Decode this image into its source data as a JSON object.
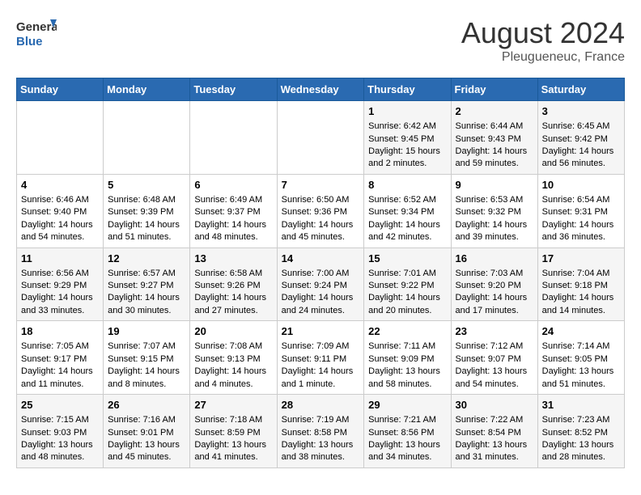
{
  "header": {
    "logo_line1": "General",
    "logo_line2": "Blue",
    "month_year": "August 2024",
    "location": "Pleugueneuc, France"
  },
  "days_of_week": [
    "Sunday",
    "Monday",
    "Tuesday",
    "Wednesday",
    "Thursday",
    "Friday",
    "Saturday"
  ],
  "weeks": [
    [
      {
        "day": "",
        "info": ""
      },
      {
        "day": "",
        "info": ""
      },
      {
        "day": "",
        "info": ""
      },
      {
        "day": "",
        "info": ""
      },
      {
        "day": "1",
        "info": "Sunrise: 6:42 AM\nSunset: 9:45 PM\nDaylight: 15 hours\nand 2 minutes."
      },
      {
        "day": "2",
        "info": "Sunrise: 6:44 AM\nSunset: 9:43 PM\nDaylight: 14 hours\nand 59 minutes."
      },
      {
        "day": "3",
        "info": "Sunrise: 6:45 AM\nSunset: 9:42 PM\nDaylight: 14 hours\nand 56 minutes."
      }
    ],
    [
      {
        "day": "4",
        "info": "Sunrise: 6:46 AM\nSunset: 9:40 PM\nDaylight: 14 hours\nand 54 minutes."
      },
      {
        "day": "5",
        "info": "Sunrise: 6:48 AM\nSunset: 9:39 PM\nDaylight: 14 hours\nand 51 minutes."
      },
      {
        "day": "6",
        "info": "Sunrise: 6:49 AM\nSunset: 9:37 PM\nDaylight: 14 hours\nand 48 minutes."
      },
      {
        "day": "7",
        "info": "Sunrise: 6:50 AM\nSunset: 9:36 PM\nDaylight: 14 hours\nand 45 minutes."
      },
      {
        "day": "8",
        "info": "Sunrise: 6:52 AM\nSunset: 9:34 PM\nDaylight: 14 hours\nand 42 minutes."
      },
      {
        "day": "9",
        "info": "Sunrise: 6:53 AM\nSunset: 9:32 PM\nDaylight: 14 hours\nand 39 minutes."
      },
      {
        "day": "10",
        "info": "Sunrise: 6:54 AM\nSunset: 9:31 PM\nDaylight: 14 hours\nand 36 minutes."
      }
    ],
    [
      {
        "day": "11",
        "info": "Sunrise: 6:56 AM\nSunset: 9:29 PM\nDaylight: 14 hours\nand 33 minutes."
      },
      {
        "day": "12",
        "info": "Sunrise: 6:57 AM\nSunset: 9:27 PM\nDaylight: 14 hours\nand 30 minutes."
      },
      {
        "day": "13",
        "info": "Sunrise: 6:58 AM\nSunset: 9:26 PM\nDaylight: 14 hours\nand 27 minutes."
      },
      {
        "day": "14",
        "info": "Sunrise: 7:00 AM\nSunset: 9:24 PM\nDaylight: 14 hours\nand 24 minutes."
      },
      {
        "day": "15",
        "info": "Sunrise: 7:01 AM\nSunset: 9:22 PM\nDaylight: 14 hours\nand 20 minutes."
      },
      {
        "day": "16",
        "info": "Sunrise: 7:03 AM\nSunset: 9:20 PM\nDaylight: 14 hours\nand 17 minutes."
      },
      {
        "day": "17",
        "info": "Sunrise: 7:04 AM\nSunset: 9:18 PM\nDaylight: 14 hours\nand 14 minutes."
      }
    ],
    [
      {
        "day": "18",
        "info": "Sunrise: 7:05 AM\nSunset: 9:17 PM\nDaylight: 14 hours\nand 11 minutes."
      },
      {
        "day": "19",
        "info": "Sunrise: 7:07 AM\nSunset: 9:15 PM\nDaylight: 14 hours\nand 8 minutes."
      },
      {
        "day": "20",
        "info": "Sunrise: 7:08 AM\nSunset: 9:13 PM\nDaylight: 14 hours\nand 4 minutes."
      },
      {
        "day": "21",
        "info": "Sunrise: 7:09 AM\nSunset: 9:11 PM\nDaylight: 14 hours\nand 1 minute."
      },
      {
        "day": "22",
        "info": "Sunrise: 7:11 AM\nSunset: 9:09 PM\nDaylight: 13 hours\nand 58 minutes."
      },
      {
        "day": "23",
        "info": "Sunrise: 7:12 AM\nSunset: 9:07 PM\nDaylight: 13 hours\nand 54 minutes."
      },
      {
        "day": "24",
        "info": "Sunrise: 7:14 AM\nSunset: 9:05 PM\nDaylight: 13 hours\nand 51 minutes."
      }
    ],
    [
      {
        "day": "25",
        "info": "Sunrise: 7:15 AM\nSunset: 9:03 PM\nDaylight: 13 hours\nand 48 minutes."
      },
      {
        "day": "26",
        "info": "Sunrise: 7:16 AM\nSunset: 9:01 PM\nDaylight: 13 hours\nand 45 minutes."
      },
      {
        "day": "27",
        "info": "Sunrise: 7:18 AM\nSunset: 8:59 PM\nDaylight: 13 hours\nand 41 minutes."
      },
      {
        "day": "28",
        "info": "Sunrise: 7:19 AM\nSunset: 8:58 PM\nDaylight: 13 hours\nand 38 minutes."
      },
      {
        "day": "29",
        "info": "Sunrise: 7:21 AM\nSunset: 8:56 PM\nDaylight: 13 hours\nand 34 minutes."
      },
      {
        "day": "30",
        "info": "Sunrise: 7:22 AM\nSunset: 8:54 PM\nDaylight: 13 hours\nand 31 minutes."
      },
      {
        "day": "31",
        "info": "Sunrise: 7:23 AM\nSunset: 8:52 PM\nDaylight: 13 hours\nand 28 minutes."
      }
    ]
  ]
}
